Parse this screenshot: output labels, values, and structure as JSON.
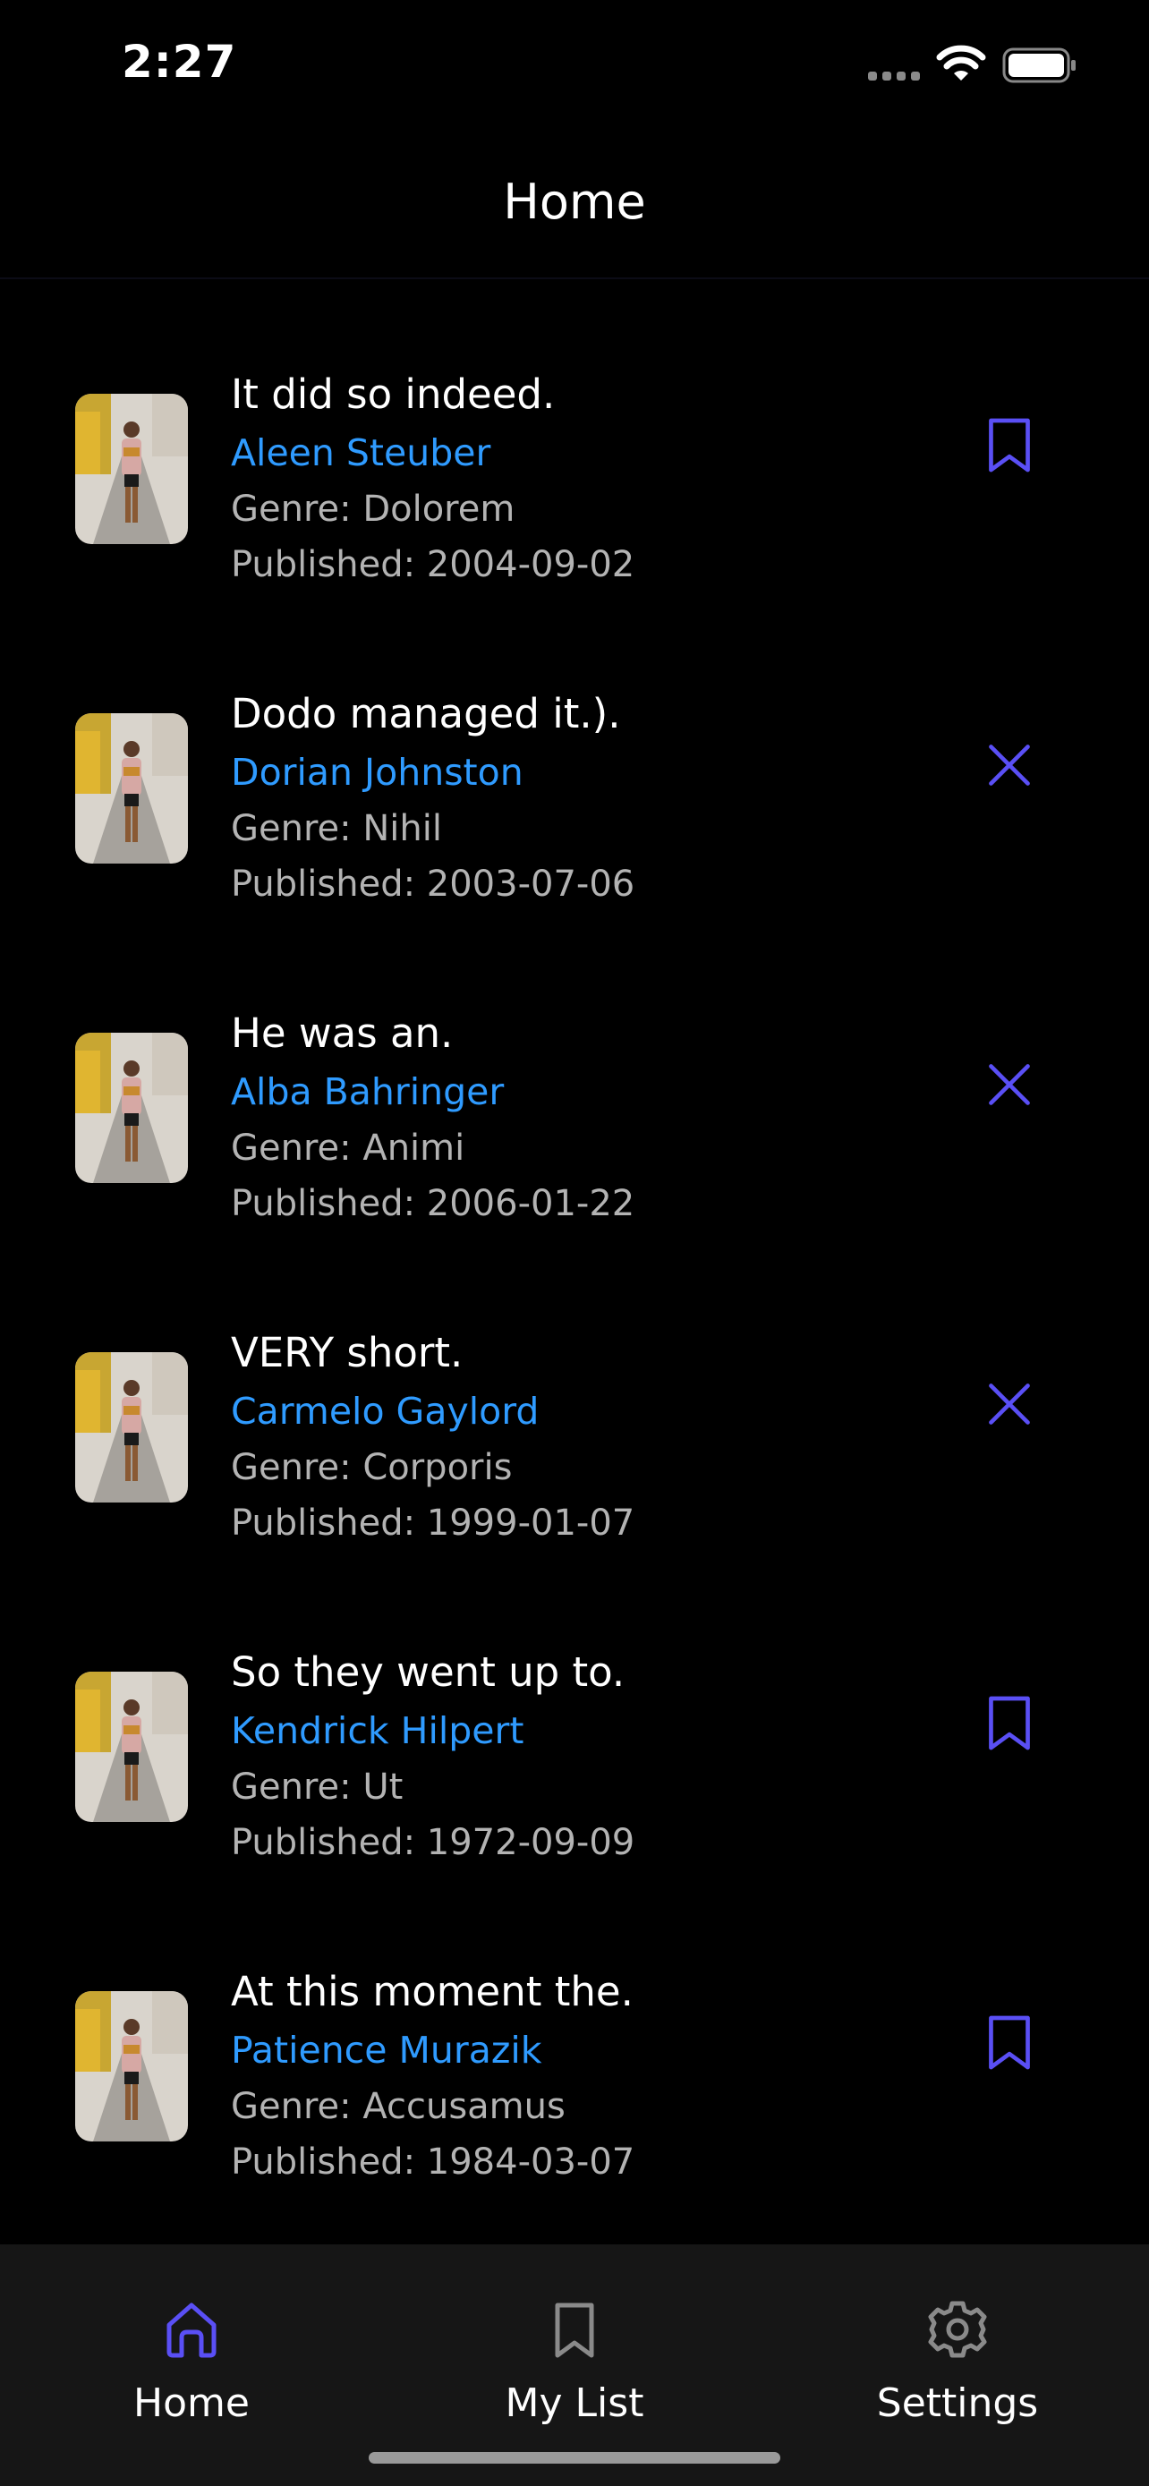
{
  "status_bar": {
    "time": "2:27"
  },
  "header": {
    "title": "Home"
  },
  "books": [
    {
      "title": "It did so indeed.",
      "author": "Aleen Steuber",
      "genre": "Genre: Dolorem",
      "published": "Published: 2004-09-02",
      "action": "bookmark-icon"
    },
    {
      "title": "Dodo managed it.).",
      "author": "Dorian Johnston",
      "genre": "Genre: Nihil",
      "published": "Published: 2003-07-06",
      "action": "remove-icon"
    },
    {
      "title": "He was an.",
      "author": "Alba Bahringer",
      "genre": "Genre: Animi",
      "published": "Published: 2006-01-22",
      "action": "remove-icon"
    },
    {
      "title": "VERY short.",
      "author": "Carmelo Gaylord",
      "genre": "Genre: Corporis",
      "published": "Published: 1999-01-07",
      "action": "remove-icon"
    },
    {
      "title": "So they went up to.",
      "author": "Kendrick Hilpert",
      "genre": "Genre: Ut",
      "published": "Published: 1972-09-09",
      "action": "bookmark-icon"
    },
    {
      "title": "At this moment the.",
      "author": "Patience Murazik",
      "genre": "Genre: Accusamus",
      "published": "Published: 1984-03-07",
      "action": "bookmark-icon"
    }
  ],
  "tabs": [
    {
      "label": "Home",
      "icon": "home-icon",
      "active": true
    },
    {
      "label": "My List",
      "icon": "bookmark-icon",
      "active": false
    },
    {
      "label": "Settings",
      "icon": "gear-icon",
      "active": false
    }
  ],
  "colors": {
    "accent": "#5a4ff5",
    "author": "#2f9bff",
    "secondary_text": "#b3b3b3",
    "tabbar_bg": "#161616"
  }
}
